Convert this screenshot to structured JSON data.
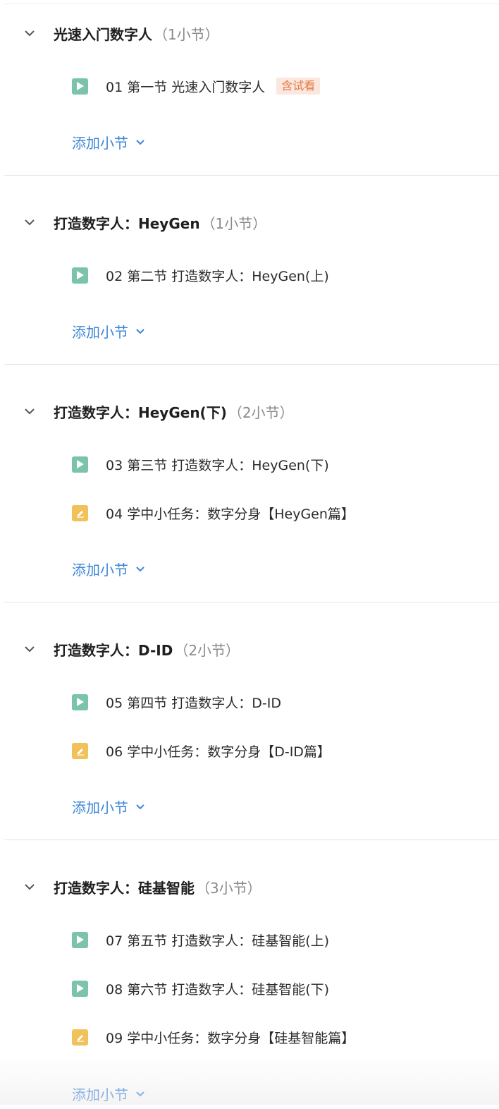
{
  "sections": [
    {
      "title": "光速入门数字人",
      "count": "（1小节）",
      "items": [
        {
          "type": "video",
          "label": "01 第一节 光速入门数字人",
          "badge": "含试看"
        }
      ],
      "add_label": "添加小节"
    },
    {
      "title": "打造数字人：HeyGen",
      "count": "（1小节）",
      "items": [
        {
          "type": "video",
          "label": "02 第二节 打造数字人：HeyGen(上)"
        }
      ],
      "add_label": "添加小节"
    },
    {
      "title": "打造数字人：HeyGen(下)",
      "count": "（2小节）",
      "items": [
        {
          "type": "video",
          "label": "03 第三节 打造数字人：HeyGen(下)"
        },
        {
          "type": "task",
          "label": "04 学中小任务：数字分身【HeyGen篇】"
        }
      ],
      "add_label": "添加小节"
    },
    {
      "title": "打造数字人：D-ID",
      "count": "（2小节）",
      "items": [
        {
          "type": "video",
          "label": "05 第四节 打造数字人：D-ID"
        },
        {
          "type": "task",
          "label": "06 学中小任务：数字分身【D-ID篇】"
        }
      ],
      "add_label": "添加小节"
    },
    {
      "title": "打造数字人：硅基智能",
      "count": "（3小节）",
      "items": [
        {
          "type": "video",
          "label": "07 第五节 打造数字人：硅基智能(上)"
        },
        {
          "type": "video",
          "label": "08 第六节 打造数字人：硅基智能(下)"
        },
        {
          "type": "task",
          "label": "09 学中小任务：数字分身【硅基智能篇】"
        }
      ],
      "add_label": "添加小节"
    }
  ],
  "colors": {
    "video_icon": "#7cc3ae",
    "task_icon": "#f2c25a",
    "link": "#3d86d6",
    "badge_text": "#e47a45",
    "badge_bg": "#fbe7dd"
  },
  "icons": {
    "section_toggle": "chevron-down-icon",
    "video_item": "play-icon",
    "task_item": "edit-icon",
    "add_toggle": "chevron-down-icon"
  }
}
